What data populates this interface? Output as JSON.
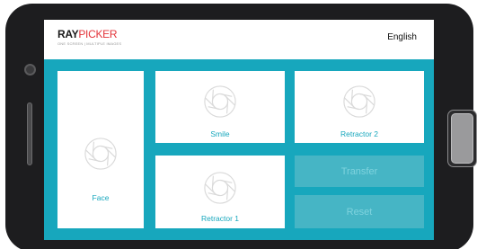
{
  "app": {
    "logo_ray": "RAY",
    "logo_picker": "PICKER",
    "logo_tagline": "ONE SCREEN | MULTIPLE IMAGES",
    "language": "English"
  },
  "tiles": {
    "face": "Face",
    "smile": "Smile",
    "retractor_2": "Retractor 2",
    "retractor_1": "Retractor 1"
  },
  "buttons": {
    "transfer": "Transfer",
    "reset": "Reset"
  },
  "colors": {
    "accent": "#17a7bd",
    "button_bg": "#46b5c5",
    "button_text": "#7fd3de",
    "logo_red": "#e3343a"
  }
}
